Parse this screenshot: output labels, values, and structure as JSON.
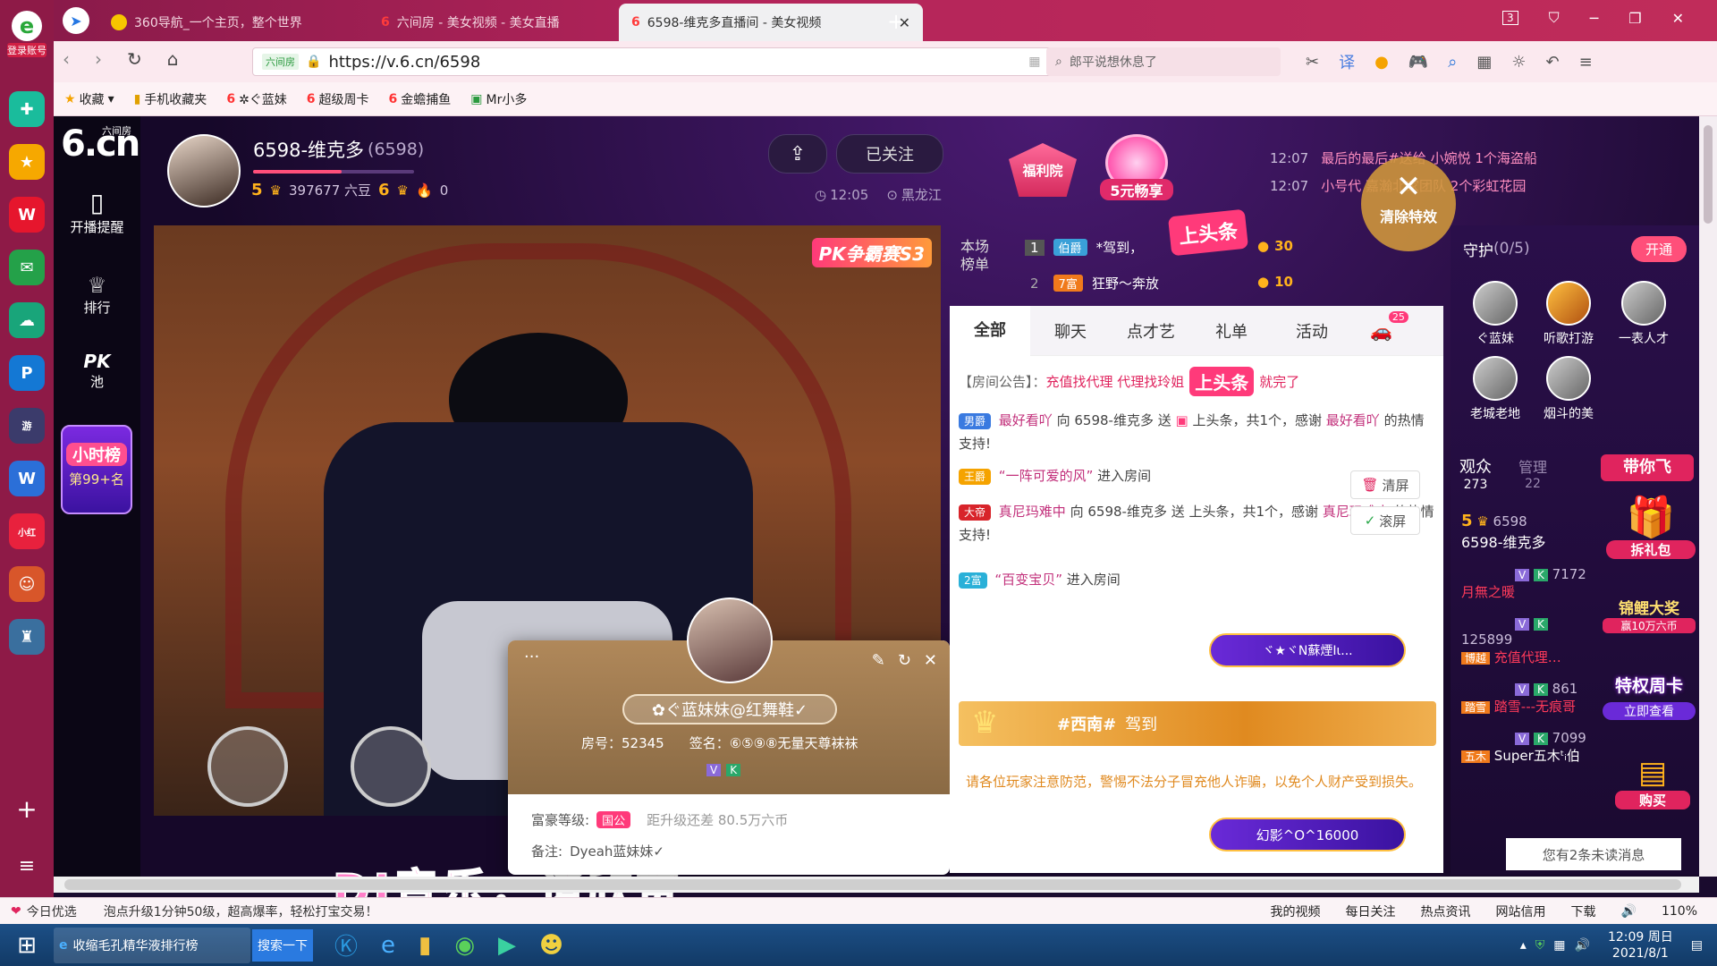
{
  "browser": {
    "login_label": "登录账号",
    "tabs": [
      {
        "title": "360导航_一个主页，整个世界"
      },
      {
        "title": "六间房 - 美女视频 - 美女直播"
      },
      {
        "title": "6598-维克多直播间 - 美女视频"
      }
    ],
    "tab_count": "3",
    "address": {
      "site_badge": "六间房",
      "url": "https://v.6.cn/6598"
    },
    "search": {
      "placeholder": "郎平说想休息了"
    },
    "bookmarks": [
      "收藏",
      "手机收藏夹",
      "✲ぐ蓝妹",
      "超级周卡",
      "金蟾捕鱼",
      "Mr小多"
    ]
  },
  "sidenav": {
    "logo_text": "6.cn",
    "logo_sub": "六间房",
    "items": [
      {
        "label": "开播提醒"
      },
      {
        "label": "排行"
      },
      {
        "label": "池",
        "prefix": "PK"
      }
    ],
    "hour_rank": {
      "title": "小时榜",
      "rank": "第99+名"
    }
  },
  "host": {
    "name": "6598-维克多",
    "room_id": "(6598)",
    "level": "5",
    "beans": "397677 六豆",
    "fan_level": "6",
    "fire": "0",
    "follow_label": "已关注",
    "time": "12:05",
    "location": "黑龙江"
  },
  "promo": {
    "welfare": "福利院",
    "five_yuan": "5元畅享",
    "clear_fx": "清除特效",
    "ticker": [
      {
        "time": "12:07",
        "text": "最后的最后#送给 小婉悦 1个海盗船"
      },
      {
        "time": "12:07",
        "text": "小号代 嘉瀚北家团队 2个彩虹花园"
      }
    ],
    "headline_tag": "上头条"
  },
  "stream": {
    "pk_badge": "PK争霸赛S3",
    "dj_caption": "DJ音乐，请欣赏"
  },
  "ranking": {
    "title": "本场榜单",
    "rows": [
      {
        "rank": "1",
        "badge": "伯爵",
        "name": "*驾到，",
        "score": "30"
      },
      {
        "rank": "2",
        "badge": "7富",
        "name": "狂野～奔放",
        "score": "10"
      }
    ]
  },
  "chat": {
    "tabs": [
      "全部",
      "聊天",
      "点才艺",
      "礼单",
      "活动"
    ],
    "car_count": "25",
    "notice_label": "【房间公告】：",
    "notice_text": "充值找代理 代理找玲姐",
    "notice_tail": "就完了",
    "headline_tag": "上头条",
    "messages": [
      {
        "badge": "男爵",
        "user": "最好看吖",
        "mid": "向 6598-维克多 送",
        "tail": "上头条，共1个，感谢",
        "user2": "最好看吖",
        "end": "的热情支持!"
      },
      {
        "badge": "王爵",
        "user": "“一阵可爱的风”",
        "tail": "进入房间"
      },
      {
        "badge": "大帝",
        "user": "真尼玛难中",
        "mid": "向 6598-维克多 送",
        "tail": "上头条，共1个，感谢",
        "user2": "真尼玛难中",
        "end": "的热情支持!"
      },
      {
        "badge": "2富",
        "user": "“百变宝贝”",
        "tail": "进入房间"
      }
    ],
    "btn_clear": "清屏",
    "btn_scroll": "滚屏",
    "arrival_name": "#西南#",
    "arrival_text": "驾到",
    "vip_pill1": "ヾ★ヾN蘇煙Ιι...",
    "vip_pill2": "幻影^O^16000",
    "warning": "请各位玩家注意防范，警惕不法分子冒充他人诈骗，以免个人财产受到损失。"
  },
  "guard": {
    "title": "守护",
    "count": "(0/5)",
    "open_label": "开通",
    "members": [
      {
        "name": "ぐ蓝妹"
      },
      {
        "name": "听歌打游"
      },
      {
        "name": "一表人才"
      },
      {
        "name": "老城老地"
      },
      {
        "name": "烟斗的美"
      }
    ],
    "fly_label": "带你飞"
  },
  "audience": {
    "tab_viewers": "观众",
    "viewers_count": "273",
    "tab_admins": "管理",
    "admins_count": "22",
    "list": [
      {
        "level": "5",
        "id": "6598",
        "name": "6598-维克多"
      },
      {
        "tag": "月無之暖",
        "num": "7172"
      },
      {
        "tag": "博越",
        "name": "充值代理…",
        "num": "125899"
      },
      {
        "tag": "踏雪",
        "name": "踏雪---无痕哥",
        "num": "861"
      },
      {
        "tag": "五木",
        "name": "Super五木ᵗᵢ伯",
        "num": "7099"
      }
    ],
    "unread": "您有2条未读消息"
  },
  "side_promos": {
    "gift": "拆礼包",
    "koi": "锦鲤大奖",
    "koi_sub": "赢10万六币",
    "weekly": "特权周卡",
    "check": "立即查看",
    "buy": "购买"
  },
  "profile": {
    "name": "✿ぐ蓝妹妹@红舞鞋✓",
    "room_label": "房号：52345",
    "sign_label": "签名：⑥⑤⑨⑧无量天尊袜袜",
    "rich_label": "富豪等级:",
    "rich_badge": "国公",
    "rich_progress": "距升级还差 80.5万六币",
    "note_label": "备注:",
    "note_value": "Dyeah蓝妹妹✓"
  },
  "statusbar": {
    "left1": "今日优选",
    "news": "泡点升级1分钟50级，超高爆率，轻松打宝交易！",
    "items": [
      "我的视频",
      "每日关注",
      "热点资讯",
      "网站信用",
      "下载"
    ],
    "zoom": "110%"
  },
  "taskbar": {
    "task1": "收缩毛孔精华液排行榜",
    "search_btn": "搜索一下",
    "time": "12:09 周日",
    "date": "2021/8/1"
  },
  "colors": {
    "accent": "#ff4f7a",
    "pink": "#c2307b",
    "gold": "#f5b21c",
    "purple": "#3b1470"
  }
}
